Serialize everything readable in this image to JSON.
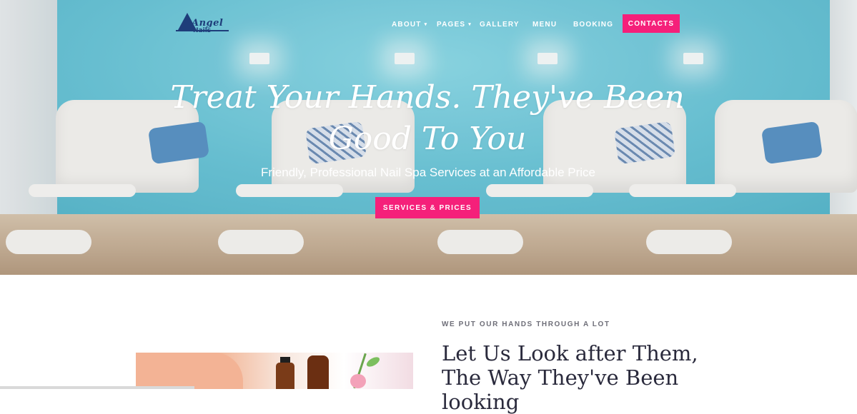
{
  "logo": {
    "line1": "Angel",
    "line2": "Nails"
  },
  "nav": {
    "items": [
      {
        "label": "ABOUT",
        "dropdown": true
      },
      {
        "label": "PAGES",
        "dropdown": true
      },
      {
        "label": "GALLERY",
        "dropdown": false
      },
      {
        "label": "MENU",
        "dropdown": false
      },
      {
        "label": "BOOKING",
        "dropdown": false
      }
    ],
    "caret": "▾",
    "contacts_label": "CONTACTS"
  },
  "hero": {
    "title": "Treat Your Hands. They've Been Good To You",
    "subtitle": "Friendly, Professional Nail Spa Services at an Affordable Price",
    "cta_label": "SERVICES & PRICES"
  },
  "about": {
    "eyebrow": "WE PUT OUR HANDS THROUGH A LOT",
    "heading": "Let Us Look after Them, The Way They've Been looking"
  },
  "colors": {
    "accent": "#f5207a",
    "logo_blue": "#1e3d7a",
    "heading_dark": "#2a2a3c"
  }
}
